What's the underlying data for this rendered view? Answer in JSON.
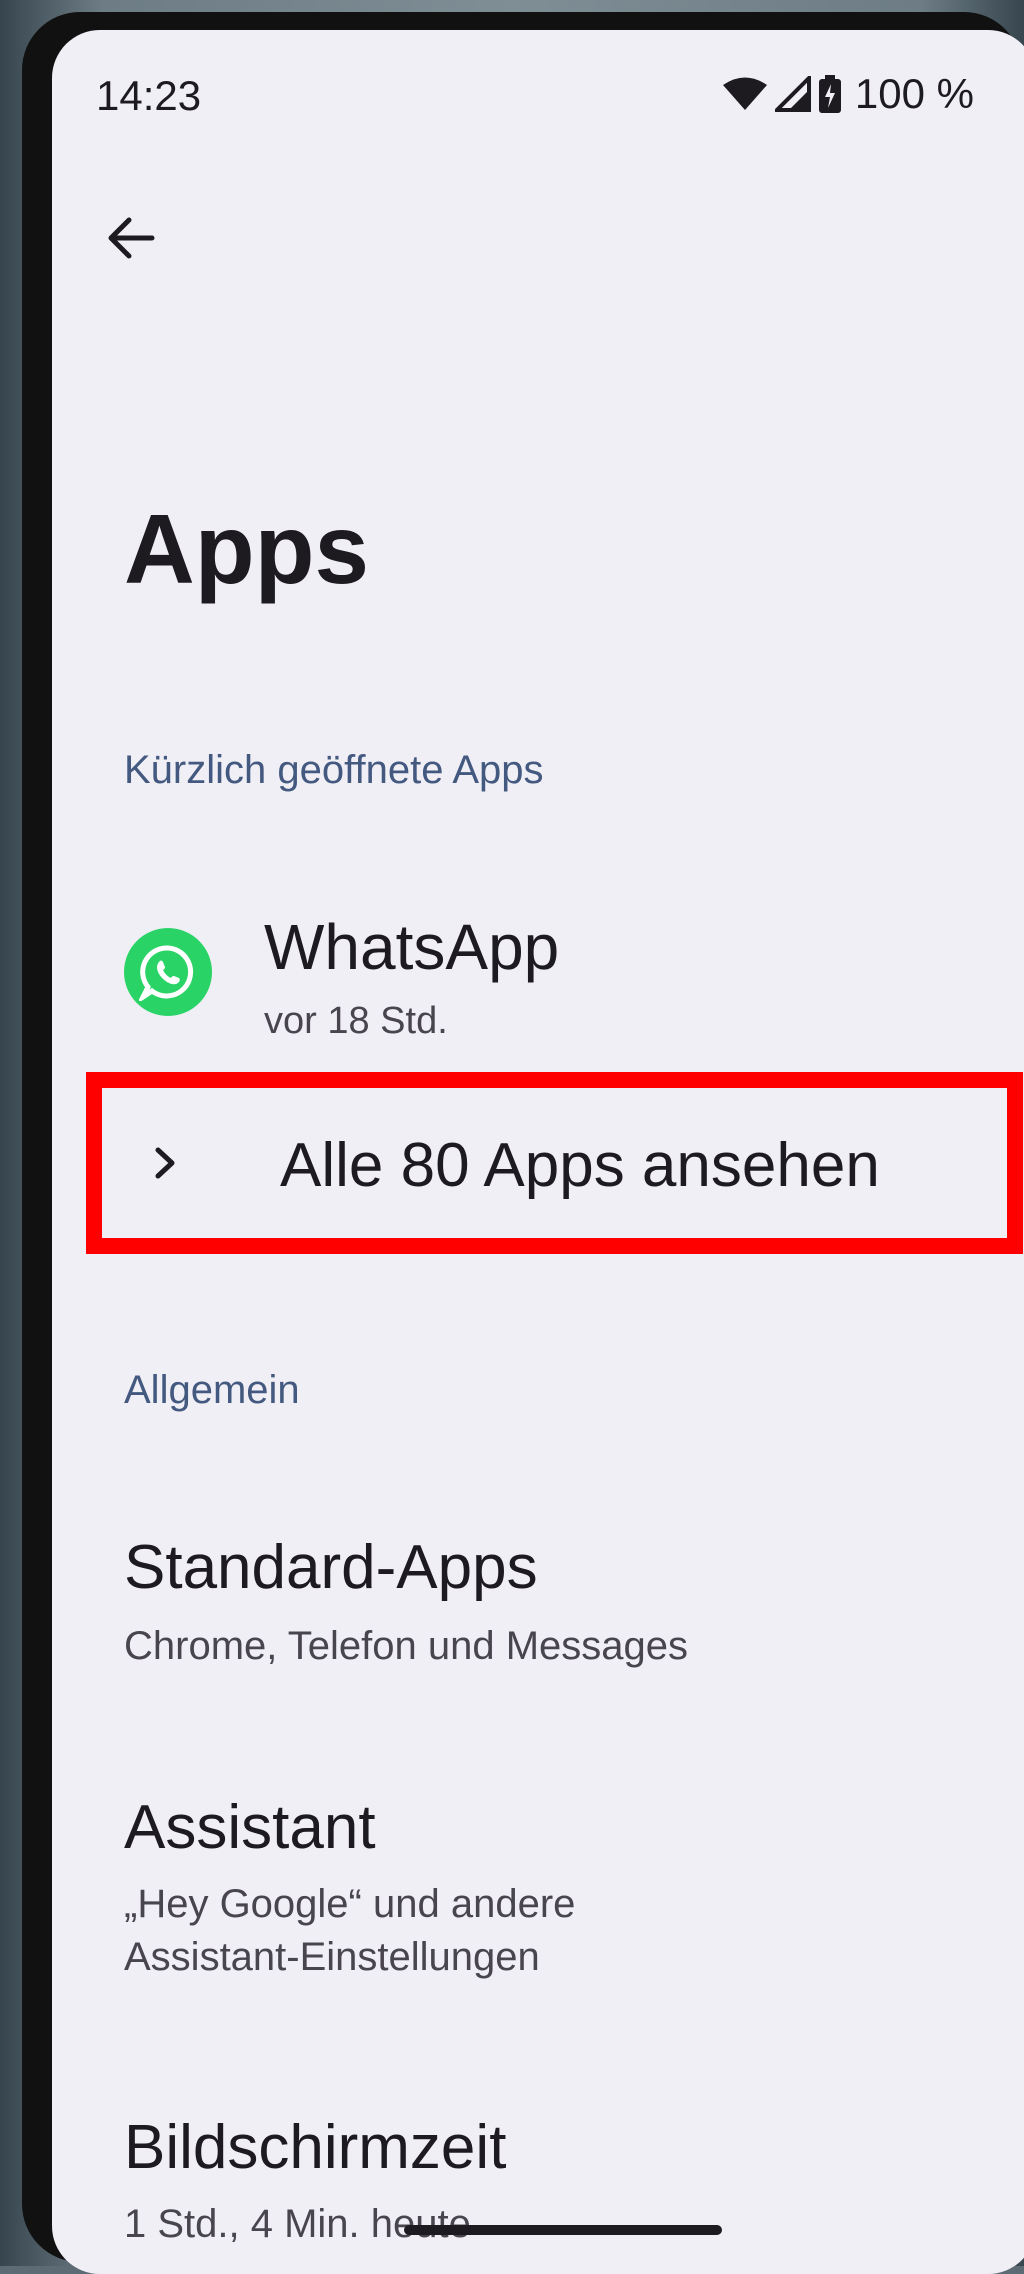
{
  "status_bar": {
    "time": "14:23",
    "battery_percent": "100 %",
    "icons": [
      "wifi-icon",
      "cellular-signal-icon",
      "battery-charging-icon"
    ]
  },
  "header": {
    "back_icon": "arrow-left-icon",
    "title": "Apps"
  },
  "recent": {
    "section_label": "Kürzlich geöffnete Apps",
    "apps": [
      {
        "name": "WhatsApp",
        "last_used": "vor 18 Std.",
        "icon": "whatsapp-icon",
        "color": "#2ad366"
      }
    ],
    "see_all_label": "Alle 80 Apps ansehen",
    "see_all_icon": "chevron-right-icon",
    "highlight_color": "#ff0000"
  },
  "general": {
    "section_label": "Allgemein",
    "items": [
      {
        "title": "Standard-Apps",
        "subtitle": "Chrome, Telefon und Messages"
      },
      {
        "title": "Assistant",
        "subtitle_lines": [
          "„Hey Google“ und andere",
          "Assistant-Einstellungen"
        ]
      },
      {
        "title": "Bildschirmzeit",
        "subtitle": "1 Std., 4 Min. heute"
      }
    ]
  },
  "colors": {
    "background": "#f1eff6",
    "section_header": "#44597f",
    "text_primary": "#1d1b20",
    "text_secondary": "#49454f"
  }
}
